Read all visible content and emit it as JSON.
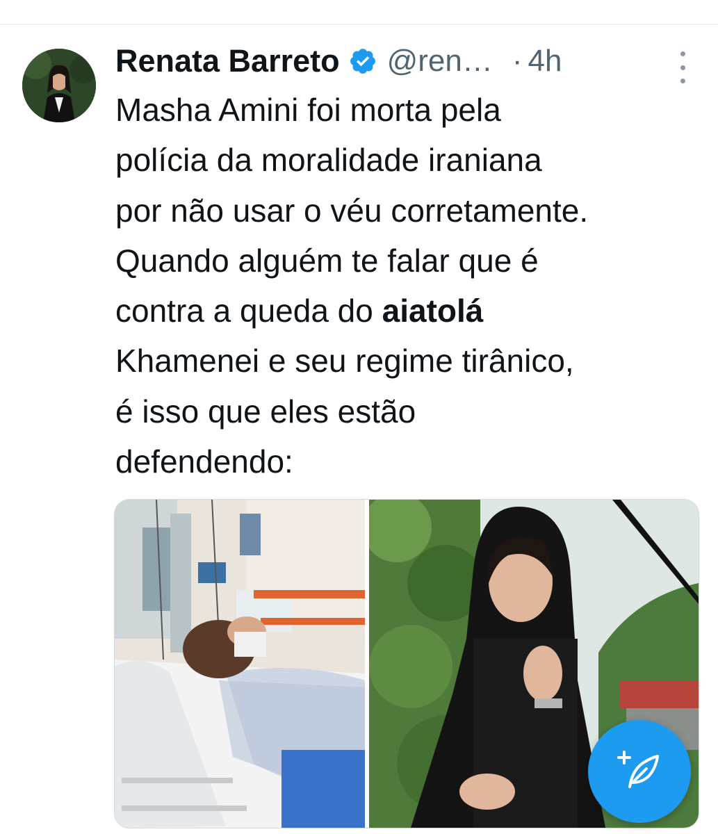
{
  "tweet": {
    "author": {
      "display_name": "Renata Barreto",
      "handle": "@ren…",
      "verified": true,
      "avatar_icon": "avatar-photo"
    },
    "separator": "·",
    "timestamp": "4h",
    "text_lines": [
      "Masha Amini foi morta pela",
      "polícia da moralidade iraniana",
      "por não usar o véu corretamente.",
      "Quando alguém te falar que é"
    ],
    "line5_prefix": "contra a queda do ",
    "line5_bold": "aiatolá",
    "text_lines_end": [
      "Khamenei e seu regime tirânico,",
      "é isso que eles estão",
      "defendendo:"
    ],
    "media": [
      {
        "kind": "photo",
        "description_icon": "hospital-photo"
      },
      {
        "kind": "photo",
        "description_icon": "portrait-photo"
      }
    ]
  },
  "fab": {
    "icon": "compose-tweet-icon"
  },
  "colors": {
    "accent": "#1d9bf0",
    "text_primary": "#0f1419",
    "text_secondary": "#536471"
  }
}
